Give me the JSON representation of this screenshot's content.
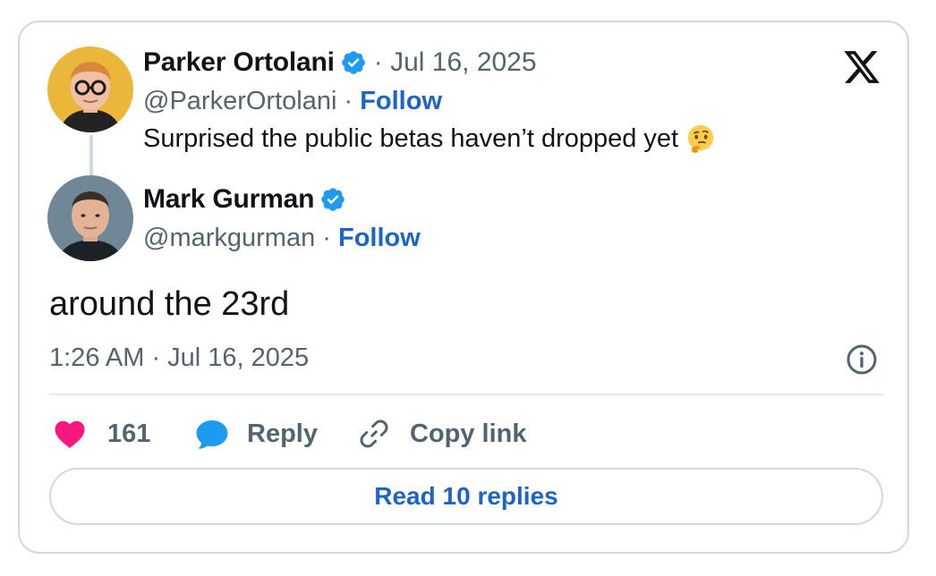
{
  "quoted_tweet": {
    "author_name": "Parker Ortolani",
    "verified": true,
    "date": "· Jul 16, 2025",
    "handle": "@ParkerOrtolani",
    "separator": " · ",
    "follow_label": "Follow",
    "text": "Surprised the public betas haven’t dropped yet",
    "emoji": "thinking-face-emoji"
  },
  "tweet": {
    "author_name": "Mark Gurman",
    "verified": true,
    "handle": "@markgurman",
    "separator": " · ",
    "follow_label": "Follow",
    "text": "around the 23rd",
    "timestamp": "1:26 AM · Jul 16, 2025"
  },
  "actions": {
    "like_count": "161",
    "reply_label": "Reply",
    "copy_link_label": "Copy link"
  },
  "read_replies_label": "Read 10 replies",
  "icons": {
    "brand": "x-logo-icon",
    "verified": "verified-badge-icon",
    "like": "heart-icon",
    "reply": "reply-bubble-icon",
    "copy": "link-icon",
    "info": "info-icon"
  },
  "colors": {
    "link_blue": "#1d64c8",
    "verified_blue": "#1d9bf0",
    "like_pink": "#f91880",
    "secondary_text": "#536471",
    "border": "#cfd9de"
  }
}
